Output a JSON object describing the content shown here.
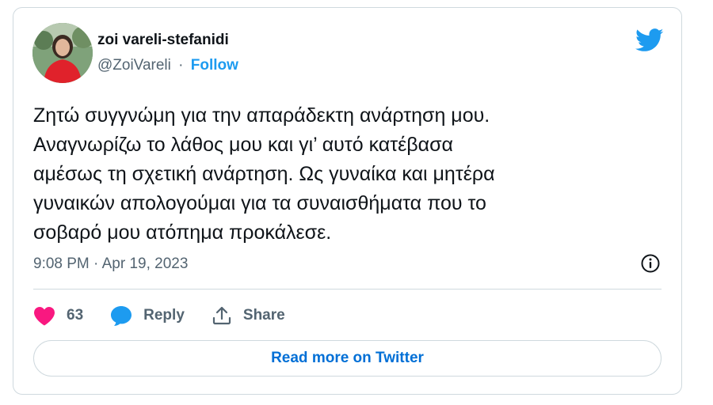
{
  "author": {
    "display_name": "zoi vareli-stefanidi",
    "handle": "@ZoiVareli",
    "separator": "·",
    "follow_label": "Follow"
  },
  "tweet": {
    "text": "Ζητώ συγγνώμη για την απαράδεκτη ανάρτηση μου.\nΑναγνωρίζω το λάθος μου και γι’ αυτό κατέβασα\nαμέσως τη σχετική ανάρτηση. Ως γυναίκα και μητέρα\nγυναικών απολογούμαι για τα συναισθήματα που το\nσοβαρό μου ατόπημα προκάλεσε.",
    "timestamp": "9:08 PM · Apr 19, 2023"
  },
  "actions": {
    "like_count": "63",
    "reply_label": "Reply",
    "share_label": "Share"
  },
  "read_more_label": "Read more on Twitter",
  "colors": {
    "brand_blue": "#1d9bf0",
    "like_pink": "#f91880",
    "text_primary": "#0f1419",
    "text_secondary": "#536471",
    "border": "#cfd9de"
  },
  "icons": {
    "brand": "twitter-bird-icon",
    "info": "info-icon",
    "like": "heart-icon",
    "reply": "speech-bubble-icon",
    "share": "share-upload-icon"
  }
}
